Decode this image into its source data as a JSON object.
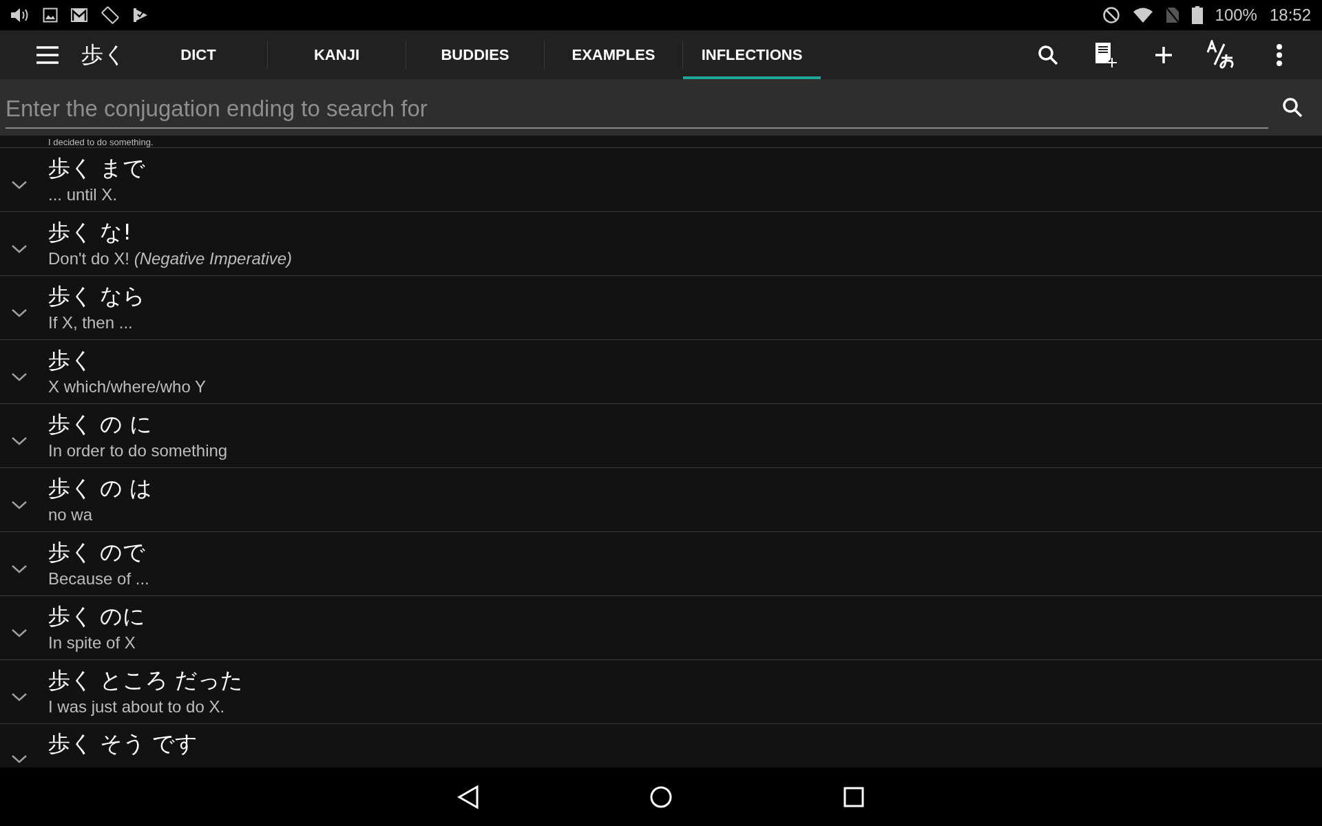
{
  "status_bar": {
    "battery": "100%",
    "time": "18:52"
  },
  "toolbar": {
    "title": "歩く",
    "tabs": [
      {
        "label": "DICT",
        "selected": false
      },
      {
        "label": "KANJI",
        "selected": false
      },
      {
        "label": "BUDDIES",
        "selected": false
      },
      {
        "label": "EXAMPLES",
        "selected": false
      },
      {
        "label": "INFLECTIONS",
        "selected": true
      }
    ]
  },
  "search": {
    "placeholder": "Enter the conjugation ending to search for"
  },
  "partial_row": {
    "meaning": "I decided to do something."
  },
  "rows": [
    {
      "title": "歩く まで",
      "meaning": "... until X."
    },
    {
      "title": "歩く な!",
      "meaning": "Don't do X! *(Negative Imperative)*"
    },
    {
      "title": "歩く なら",
      "meaning": "If X, then ..."
    },
    {
      "title": "歩く",
      "meaning": "X which/where/who Y"
    },
    {
      "title": "歩く の に",
      "meaning": "In order to do something"
    },
    {
      "title": "歩く の は",
      "meaning": "no wa"
    },
    {
      "title": "歩く ので",
      "meaning": "Because of ..."
    },
    {
      "title": "歩く のに",
      "meaning": "In spite of X"
    },
    {
      "title": "歩く ところ だった",
      "meaning": "I was just about to do X."
    },
    {
      "title": "歩く そう です"
    }
  ]
}
